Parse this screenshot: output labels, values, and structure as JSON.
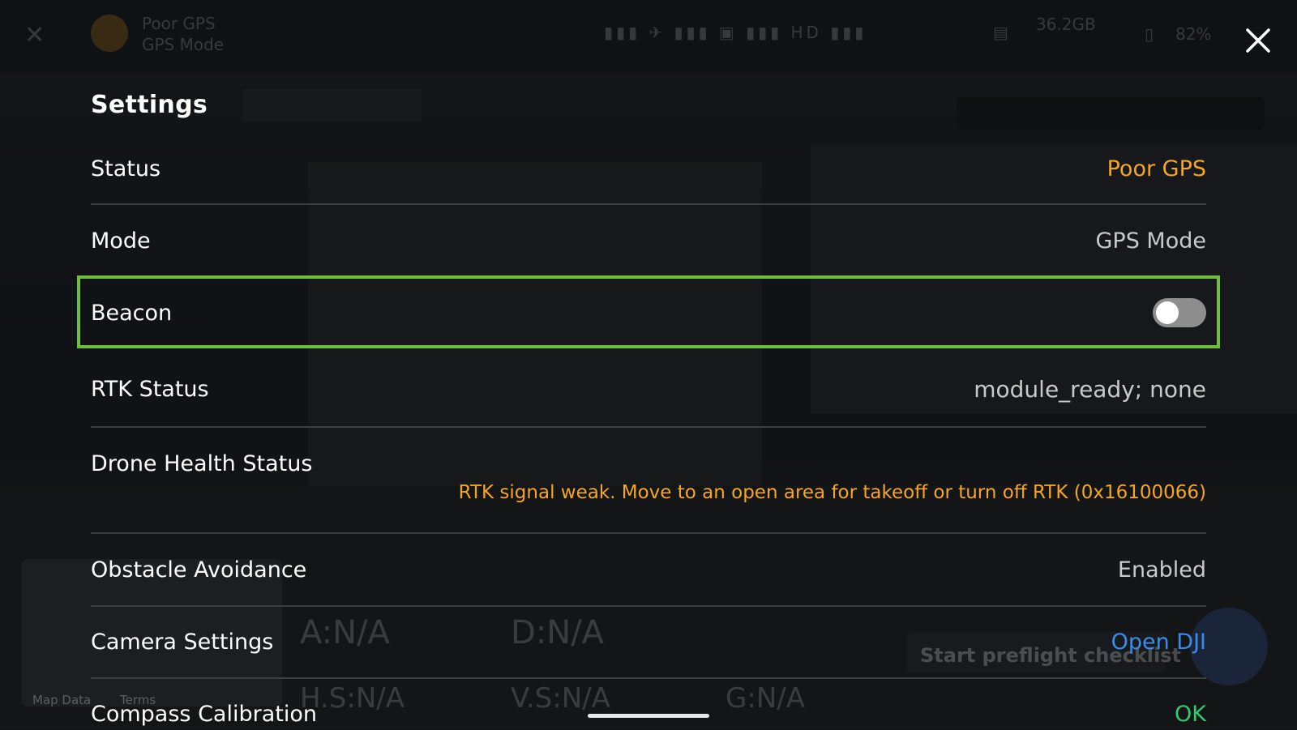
{
  "background_hud": {
    "gps_status": "Poor GPS",
    "gps_mode": "GPS Mode",
    "storage": "36.2GB",
    "battery": "82%",
    "altitude_label": "A:",
    "altitude_value": "N/A",
    "distance_label": "D:",
    "distance_value": "N/A",
    "hspeed_label": "H.S:",
    "hspeed_value": "N/A",
    "vspeed_label": "V.S:",
    "vspeed_value": "N/A",
    "gimbal_label": "G:",
    "gimbal_value": "N/A",
    "map_data": "Map Data",
    "map_terms": "Terms",
    "preflight": "Start preflight checklist"
  },
  "settings": {
    "title": "Settings",
    "rows": {
      "status": {
        "label": "Status",
        "value": "Poor GPS"
      },
      "mode": {
        "label": "Mode",
        "value": "GPS Mode"
      },
      "beacon": {
        "label": "Beacon",
        "enabled": false
      },
      "rtk_status": {
        "label": "RTK Status",
        "value": "module_ready; none"
      },
      "drone_health": {
        "label": "Drone Health Status",
        "warning": "RTK signal weak. Move to an open area for takeoff or turn off RTK (0x16100066)"
      },
      "obstacle_avoidance": {
        "label": "Obstacle Avoidance",
        "value": "Enabled"
      },
      "camera_settings": {
        "label": "Camera Settings",
        "value": "Open DJI"
      },
      "compass_calibration": {
        "label": "Compass Calibration",
        "value": "OK"
      }
    }
  },
  "colors": {
    "warning": "#f5a623",
    "link": "#3b8bea",
    "ok": "#2ecc71",
    "highlight": "#6fbf3a"
  },
  "icons": {
    "close": "close-icon"
  }
}
